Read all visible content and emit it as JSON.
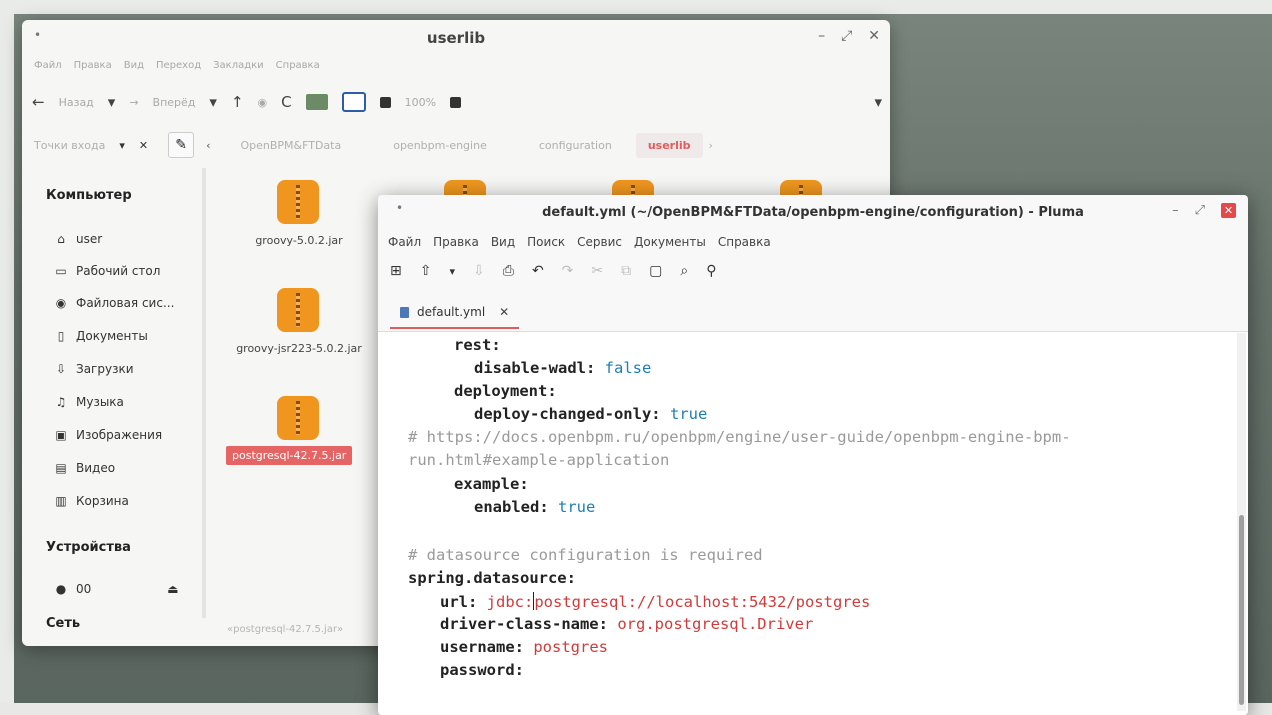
{
  "file_manager": {
    "title": "userlib",
    "menu": [
      "Файл",
      "Правка",
      "Вид",
      "Переход",
      "Закладки",
      "Справка"
    ],
    "toolbar": {
      "back": "Назад",
      "forward": "Вперёд",
      "zoom": "100%"
    },
    "location": {
      "places_label": "Точки входа",
      "crumbs": [
        "OpenBPM&FTData",
        "openbpm-engine",
        "configuration",
        "userlib"
      ]
    },
    "sidebar": {
      "computer_header": "Компьютер",
      "items": [
        {
          "label": "user",
          "icon": "home-icon"
        },
        {
          "label": "Рабочий стол",
          "icon": "desktop-icon"
        },
        {
          "label": "Файловая сис...",
          "icon": "drive-icon"
        },
        {
          "label": "Документы",
          "icon": "documents-icon"
        },
        {
          "label": "Загрузки",
          "icon": "download-icon"
        },
        {
          "label": "Музыка",
          "icon": "music-icon"
        },
        {
          "label": "Изображения",
          "icon": "pictures-icon"
        },
        {
          "label": "Видео",
          "icon": "video-icon"
        },
        {
          "label": "Корзина",
          "icon": "trash-icon"
        }
      ],
      "devices_header": "Устройства",
      "device": "00",
      "network_header": "Сеть"
    },
    "files": [
      "groovy-5.0.2.jar",
      "groovy-jsr223-5.0.2.jar",
      "postgresql-42.7.5.jar"
    ],
    "status": "«postgresql-42.7.5.jar»"
  },
  "pluma": {
    "title": "default.yml (~/OpenBPM&FTData/openbpm-engine/configuration) - Pluma",
    "menu": [
      "Файл",
      "Правка",
      "Вид",
      "Поиск",
      "Сервис",
      "Документы",
      "Справка"
    ],
    "tab": "default.yml",
    "code": {
      "l1": "rest:",
      "l2_key": "disable-wadl:",
      "l2_val": "false",
      "l3": "deployment:",
      "l4_key": "deploy-changed-only:",
      "l4_val": "true",
      "l5": "# https://docs.openbpm.ru/openbpm/engine/user-guide/openbpm-engine-bpm-",
      "l6": "run.html#example-application",
      "l7": "example:",
      "l8_key": "enabled:",
      "l8_val": "true",
      "l10": "# datasource configuration is required",
      "l11": "spring.datasource:",
      "l12_key": "url:",
      "l12_val_a": "jdbc:",
      "l12_val_b": "postgresql://localhost:5432/postgres",
      "l13_key": "driver-class-name:",
      "l13_val": "org.postgresql.Driver",
      "l14_key": "username:",
      "l14_val": "postgres",
      "l15_key": "password:"
    }
  }
}
